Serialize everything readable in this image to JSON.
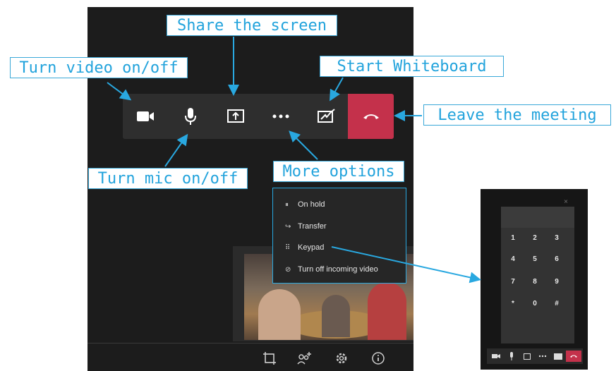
{
  "callouts": {
    "share_screen": "Share the screen",
    "video": "Turn video on/off",
    "whiteboard": "Start Whiteboard",
    "leave": "Leave the meeting",
    "mic": "Turn mic on/off",
    "more": "More options"
  },
  "menu": {
    "items": [
      {
        "label": "On hold",
        "icon": "pause-icon"
      },
      {
        "label": "Transfer",
        "icon": "transfer-icon"
      },
      {
        "label": "Keypad",
        "icon": "keypad-icon"
      },
      {
        "label": "Turn off incoming video",
        "icon": "video-off-icon"
      }
    ]
  },
  "keypad": {
    "keys": [
      "1",
      "2",
      "3",
      "4",
      "5",
      "6",
      "7",
      "8",
      "9",
      "*",
      "0",
      "#"
    ]
  },
  "phone": {
    "close_label": "×"
  },
  "colors": {
    "callout_text": "#22a3dc",
    "leave_red": "#c4314b",
    "toolbar": "#2e2e2e",
    "window": "#1c1c1c"
  }
}
